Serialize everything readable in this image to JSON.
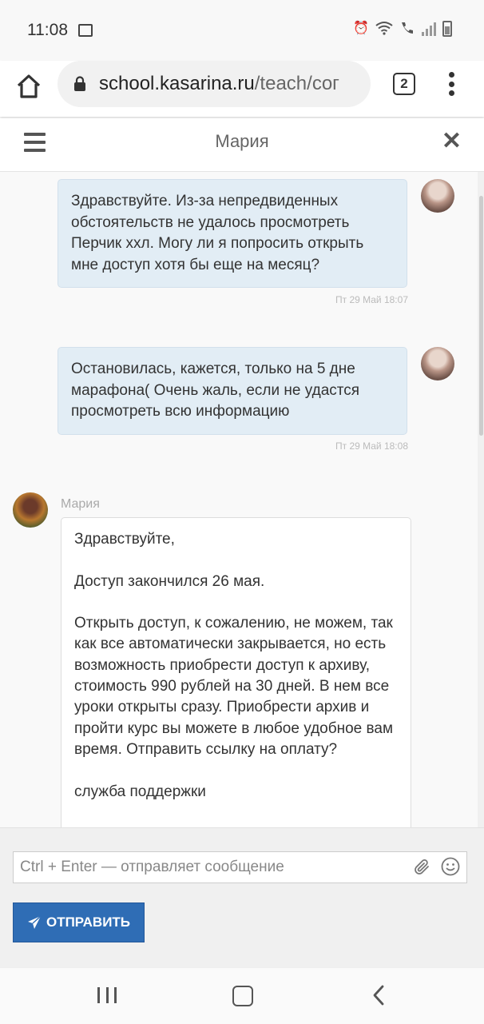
{
  "status": {
    "time": "11:08"
  },
  "browser": {
    "url_host": "school.kasarina.ru",
    "url_path": "/teach/coг",
    "tab_count": "2"
  },
  "chat": {
    "title": "Мария",
    "messages": [
      {
        "text": "Здравствуйте. Из-за непредвиденных обстоятельств не удалось просмотреть Перчик ххл. Могу ли я попросить открыть мне доступ хотя бы еще на месяц?",
        "time": "Пт 29 Май 18:07"
      },
      {
        "text": "Остановилась, кажется, только на 5 дне марафона( Очень жаль, если не удастся просмотреть всю информацию",
        "time": "Пт 29 Май 18:08"
      }
    ],
    "reply": {
      "sender": "Мария",
      "text": "Здравствуйте,\n\nДоступ закончился 26 мая.\n\nОткрыть доступ, к сожалению, не можем, так как все автоматически закрывается, но есть возможность приобрести доступ к архиву, стоимость 990 рублей на 30 дней. В нем все уроки открыты сразу. Приобрести архив и пройти курс вы можете в любое удобное вам время. Отправить ссылку на оплату?\n\nслужба поддержки"
    }
  },
  "composer": {
    "placeholder": "Ctrl + Enter — отправляет сообщение",
    "send_label": "ОТПРАВИТЬ"
  },
  "colors": {
    "accent": "#2f6db5",
    "bubble_out": "#e2edf5"
  }
}
